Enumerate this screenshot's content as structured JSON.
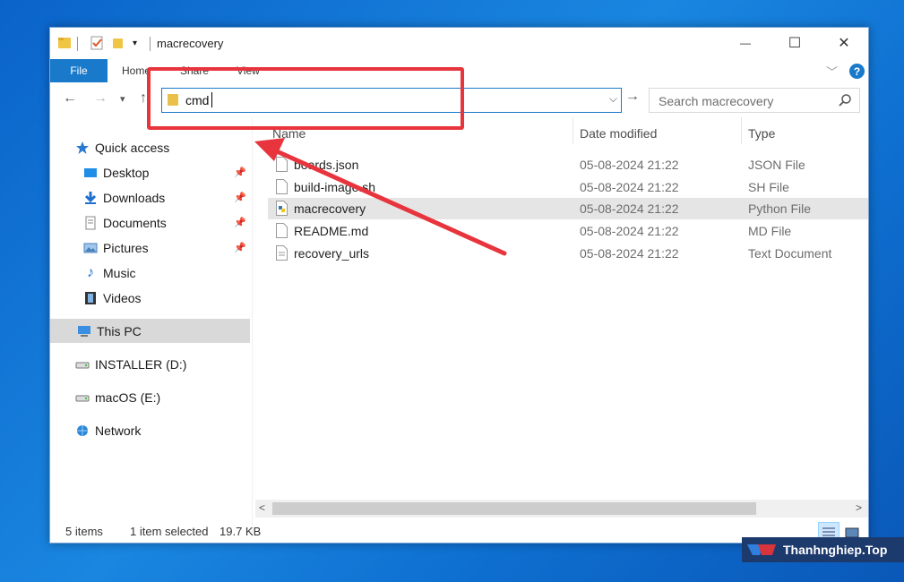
{
  "window": {
    "title": "macrecovery",
    "controls": {
      "minimize": "—",
      "maximize": "☐",
      "close": "✕"
    }
  },
  "ribbon": {
    "tabs": [
      "File",
      "Home",
      "Share",
      "View"
    ],
    "help": "?"
  },
  "nav": {
    "address_value": "cmd",
    "search_placeholder": "Search macrecovery"
  },
  "sidebar": {
    "items": [
      {
        "label": "Quick access",
        "icon": "star-icon"
      },
      {
        "label": "Desktop",
        "icon": "desktop-icon",
        "pinned": true
      },
      {
        "label": "Downloads",
        "icon": "download-icon",
        "pinned": true
      },
      {
        "label": "Documents",
        "icon": "documents-icon",
        "pinned": true
      },
      {
        "label": "Pictures",
        "icon": "pictures-icon",
        "pinned": true
      },
      {
        "label": "Music",
        "icon": "music-icon"
      },
      {
        "label": "Videos",
        "icon": "videos-icon"
      },
      {
        "label": "This PC",
        "icon": "computer-icon",
        "selected": true
      },
      {
        "label": "INSTALLER (D:)",
        "icon": "drive-icon"
      },
      {
        "label": "macOS (E:)",
        "icon": "drive-icon"
      },
      {
        "label": "Network",
        "icon": "network-icon"
      }
    ]
  },
  "columns": {
    "name": "Name",
    "date": "Date modified",
    "type": "Type"
  },
  "files": [
    {
      "name": "boards.json",
      "date": "05-08-2024 21:22",
      "type": "JSON File",
      "icon": "file-icon"
    },
    {
      "name": "build-image.sh",
      "date": "05-08-2024 21:22",
      "type": "SH File",
      "icon": "file-icon"
    },
    {
      "name": "macrecovery",
      "date": "05-08-2024 21:22",
      "type": "Python File",
      "icon": "python-file-icon",
      "selected": true
    },
    {
      "name": "README.md",
      "date": "05-08-2024 21:22",
      "type": "MD File",
      "icon": "file-icon"
    },
    {
      "name": "recovery_urls",
      "date": "05-08-2024 21:22",
      "type": "Text Document",
      "icon": "text-file-icon"
    }
  ],
  "status": {
    "count": "5 items",
    "selection": "1 item selected",
    "size": "19.7 KB"
  },
  "watermark": {
    "text": "Thanhnghiep.Top"
  },
  "colors": {
    "accent": "#1979ca",
    "annotation": "#e8343c",
    "selection": "#e5e5e5"
  }
}
